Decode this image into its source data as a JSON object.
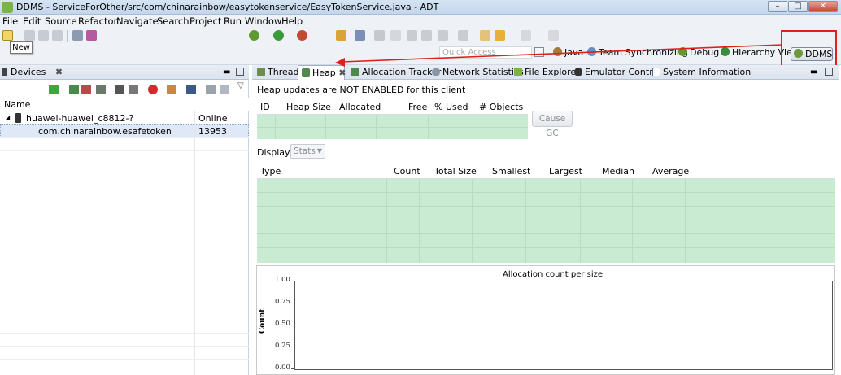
{
  "window": {
    "title": "DDMS - ServiceForOther/src/com/chinarainbow/easytokenservice/EasyTokenService.java - ADT"
  },
  "menu": [
    "File",
    "Edit",
    "Source",
    "Refactor",
    "Navigate",
    "Search",
    "Project",
    "Run",
    "Window",
    "Help"
  ],
  "toolbar": {
    "tooltip": "New",
    "quick_access": "Quick Access"
  },
  "perspectives": [
    {
      "label": "Java",
      "icon": "java-perspective-icon"
    },
    {
      "label": "Team Synchronizing",
      "icon": "team-sync-icon"
    },
    {
      "label": "Debug",
      "icon": "debug-icon"
    },
    {
      "label": "Hierarchy View",
      "icon": "hierarchy-icon"
    },
    {
      "label": "DDMS",
      "icon": "ddms-icon"
    }
  ],
  "devices": {
    "tab_label": "Devices",
    "columns": [
      "Name",
      ""
    ],
    "rows": [
      {
        "name": "huawei-huawei_c8812-?",
        "value": "Online"
      },
      {
        "name": "com.chinarainbow.esafetoken",
        "value": "13953"
      }
    ]
  },
  "tabs": [
    "Threads",
    "Heap",
    "Allocation Tracker",
    "Network Statistics",
    "File Explorer",
    "Emulator Control",
    "System Information"
  ],
  "heap": {
    "status": "Heap updates are NOT ENABLED for this client",
    "columns": [
      "ID",
      "Heap Size",
      "Allocated",
      "Free",
      "% Used",
      "# Objects"
    ],
    "cause_gc": "Cause GC",
    "display_label": "Display:",
    "display_value": "Stats",
    "stats_columns": [
      "Type",
      "Count",
      "Total Size",
      "Smallest",
      "Largest",
      "Median",
      "Average"
    ]
  },
  "chart_data": {
    "type": "bar",
    "title": "Allocation count per size",
    "ylabel": "Count",
    "xlabel": "",
    "ylim": [
      0,
      1
    ],
    "yticks": [
      "1.00",
      "0.75",
      "0.50",
      "0.25",
      "0.00"
    ],
    "categories": [],
    "values": []
  },
  "colors": {
    "accent_red": "#e0201a",
    "heap_green": "#c9ebd2"
  }
}
